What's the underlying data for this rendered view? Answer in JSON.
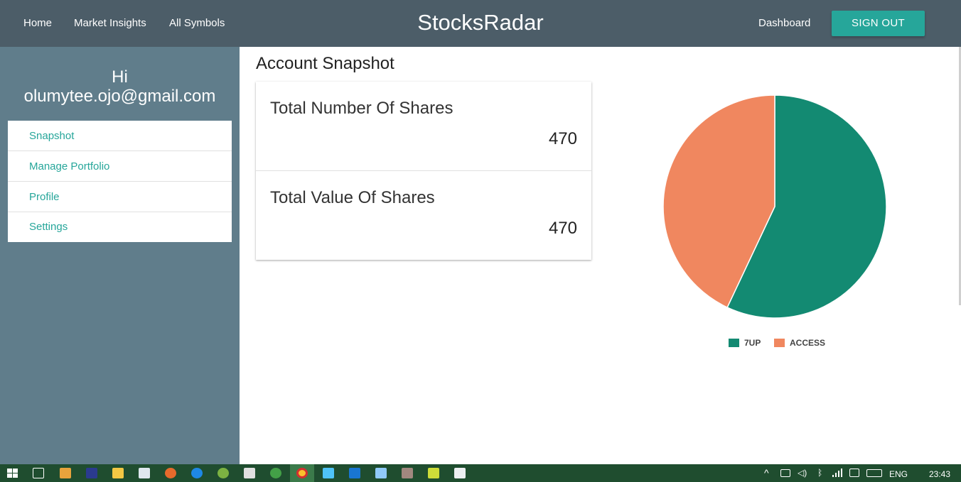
{
  "navbar": {
    "links": [
      "Home",
      "Market Insights",
      "All Symbols"
    ],
    "brand": "StocksRadar",
    "dashboard": "Dashboard",
    "sign_out": "SIGN OUT"
  },
  "sidebar": {
    "greeting_hi": "Hi",
    "greeting_email": "olumytee.ojo@gmail.com",
    "items": [
      {
        "label": "Snapshot"
      },
      {
        "label": "Manage Portfolio"
      },
      {
        "label": "Profile"
      },
      {
        "label": "Settings"
      }
    ]
  },
  "main": {
    "title": "Account Snapshot",
    "stats": [
      {
        "label": "Total Number Of Shares",
        "value": "470"
      },
      {
        "label": "Total Value Of Shares",
        "value": "470"
      }
    ]
  },
  "chart_data": {
    "type": "pie",
    "labels": [
      "7UP",
      "ACCESS"
    ],
    "values": [
      57,
      43
    ],
    "colors": [
      "#138a72",
      "#f0875f"
    ],
    "legend": "bottom"
  },
  "taskbar": {
    "language": "ENG",
    "time": "23:43",
    "icons": [
      "windows-start-icon",
      "task-view-icon",
      "media-player-icon",
      "app-icon",
      "file-explorer-icon",
      "store-icon",
      "firefox-icon",
      "edge-icon",
      "utorrent-icon",
      "mail-icon",
      "app-icon",
      "chrome-icon",
      "app-icon",
      "app-icon",
      "app-icon",
      "app-icon",
      "app-icon",
      "app-icon"
    ]
  }
}
